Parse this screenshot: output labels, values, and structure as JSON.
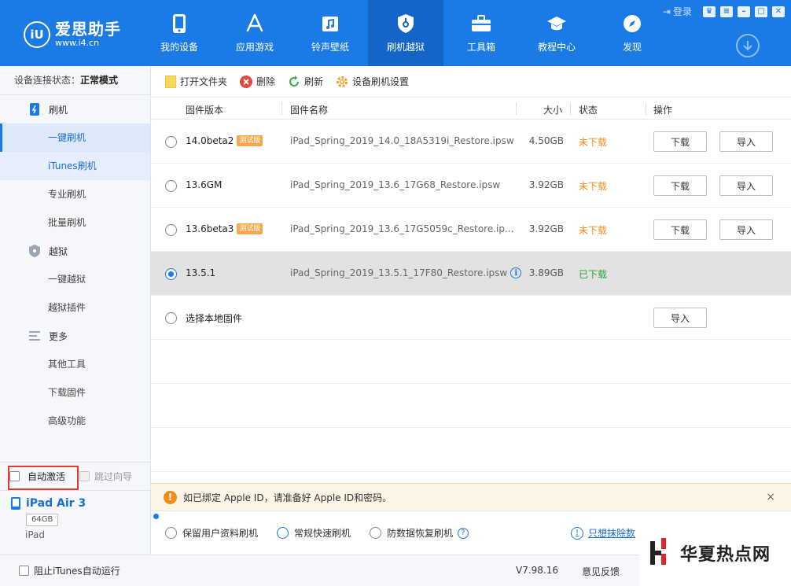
{
  "app": {
    "logo_mark": "iU",
    "logo_title": "爱思助手",
    "logo_url": "www.i4.cn",
    "login_label": "登录"
  },
  "nav": [
    {
      "label": "我的设备",
      "icon": "phone-icon"
    },
    {
      "label": "应用游戏",
      "icon": "app-store-icon"
    },
    {
      "label": "铃声壁纸",
      "icon": "music-folder-icon"
    },
    {
      "label": "刷机越狱",
      "icon": "shield-icon",
      "active": true
    },
    {
      "label": "工具箱",
      "icon": "toolbox-icon"
    },
    {
      "label": "教程中心",
      "icon": "graduation-cap-icon"
    },
    {
      "label": "发现",
      "icon": "compass-icon"
    }
  ],
  "sidebar": {
    "conn_label": "设备连接状态：",
    "conn_value": "正常模式",
    "groups": [
      {
        "label": "刷机",
        "icon": "flash-icon",
        "items": [
          "一键刷机",
          "iTunes刷机",
          "专业刷机",
          "批量刷机"
        ]
      },
      {
        "label": "越狱",
        "icon": "jailbreak-icon",
        "items": [
          "一键越狱",
          "越狱插件"
        ]
      },
      {
        "label": "更多",
        "icon": "menu-icon",
        "items": [
          "其他工具",
          "下载固件",
          "高级功能"
        ]
      }
    ],
    "auto_activate": "自动激活",
    "skip_guide": "跳过向导",
    "device_name": "iPad Air 3",
    "device_capacity": "64GB",
    "device_type": "iPad"
  },
  "toolbar": {
    "open_folder": "打开文件夹",
    "delete": "删除",
    "refresh": "刷新",
    "settings": "设备刷机设置"
  },
  "table": {
    "headers": {
      "version": "固件版本",
      "name": "固件名称",
      "size": "大小",
      "status": "状态",
      "ops": "操作"
    },
    "rows": [
      {
        "version": "14.0beta2",
        "tag": "测试版",
        "name": "iPad_Spring_2019_14.0_18A5319i_Restore.ipsw",
        "size": "4.50GB",
        "status": "未下载",
        "download": "下载",
        "import": "导入"
      },
      {
        "version": "13.6GM",
        "tag": "",
        "name": "iPad_Spring_2019_13.6_17G68_Restore.ipsw",
        "size": "3.92GB",
        "status": "未下载",
        "download": "下载",
        "import": "导入"
      },
      {
        "version": "13.6beta3",
        "tag": "测试版",
        "name": "iPad_Spring_2019_13.6_17G5059c_Restore.ip...",
        "size": "3.92GB",
        "status": "未下载",
        "download": "下载",
        "import": "导入"
      },
      {
        "version": "13.5.1",
        "tag": "",
        "name": "iPad_Spring_2019_13.5.1_17F80_Restore.ipsw",
        "size": "3.89GB",
        "status": "已下载",
        "download": "",
        "import": ""
      }
    ],
    "local_label": "选择本地固件",
    "local_import": "导入"
  },
  "notice": {
    "text": "如已绑定 Apple ID，请准备好 Apple ID和密码。",
    "close": "×"
  },
  "modes": {
    "keep_data": "保留用户资料刷机",
    "quick": "常规快速刷机",
    "recovery": "防数据恢复刷机",
    "erase_link": "只想抹除数"
  },
  "statusbar": {
    "itunes": "阻止iTunes自动运行",
    "version": "V7.98.16",
    "feedback": "意见反馈"
  },
  "watermark": {
    "text": "华夏热点网"
  },
  "colors": {
    "brand": "#1a7ae6",
    "warning": "#f08c1b",
    "success": "#2aa33a"
  }
}
